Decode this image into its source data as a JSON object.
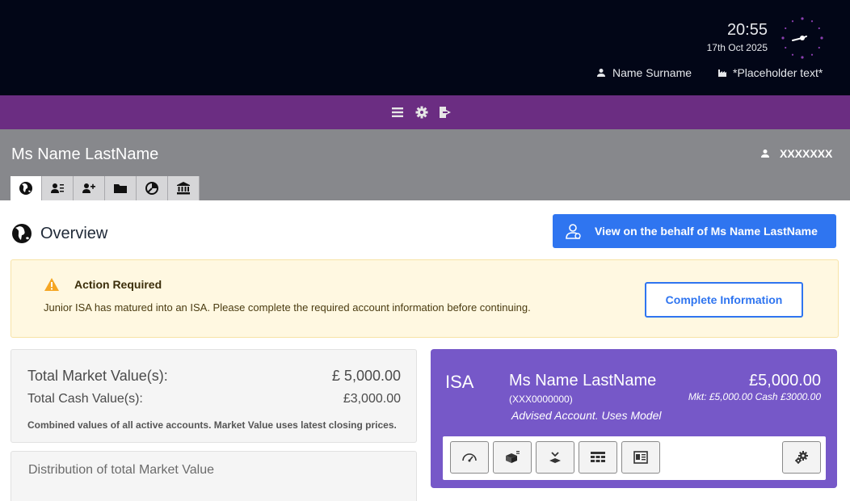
{
  "header": {
    "time": "20:55",
    "date": "17th Oct 2025",
    "user_name": "Name Surname",
    "org_name": "*Placeholder text*"
  },
  "client": {
    "name": "Ms Name LastName",
    "id": "XXXXXXX"
  },
  "overview": {
    "title": "Overview",
    "behalf_label": "View on the behalf of  Ms Name LastName"
  },
  "alert": {
    "title": "Action Required",
    "message": "Junior ISA has matured into an ISA. Please complete the required account information before continuing.",
    "button": "Complete Information",
    "color": "#f5a623"
  },
  "totals": {
    "market_label": "Total Market Value(s):",
    "market_value": "£ 5,000.00",
    "cash_label": "Total Cash Value(s):",
    "cash_value": "£3,000.00",
    "note": "Combined values of all active accounts. Market Value uses latest closing prices."
  },
  "distribution": {
    "title": "Distribution of total Market Value"
  },
  "isa": {
    "type": "ISA",
    "holder": "Ms Name LastName",
    "ref": "(XXX0000000)",
    "desc": "Advised Account.   Uses Model",
    "value": "£5,000.00",
    "sub": "Mkt: £5,000.00 Cash £3000.00"
  },
  "colors": {
    "header_bg": "#020617",
    "nav_bg": "#6b2d82",
    "client_bg": "#87888c",
    "accent": "#2f75f0",
    "isa_bg": "#7658c8"
  },
  "icons": {
    "nav": [
      "menu-icon",
      "gear-icon",
      "logout-icon"
    ],
    "tabs": [
      "globe-icon",
      "client-list-icon",
      "add-client-icon",
      "folder-icon",
      "pie-chart-icon",
      "bank-icon"
    ],
    "isa_tools": [
      "speedometer-icon",
      "holdings-box-icon",
      "download-icon",
      "table-icon",
      "statement-icon",
      "settings-icon"
    ]
  }
}
